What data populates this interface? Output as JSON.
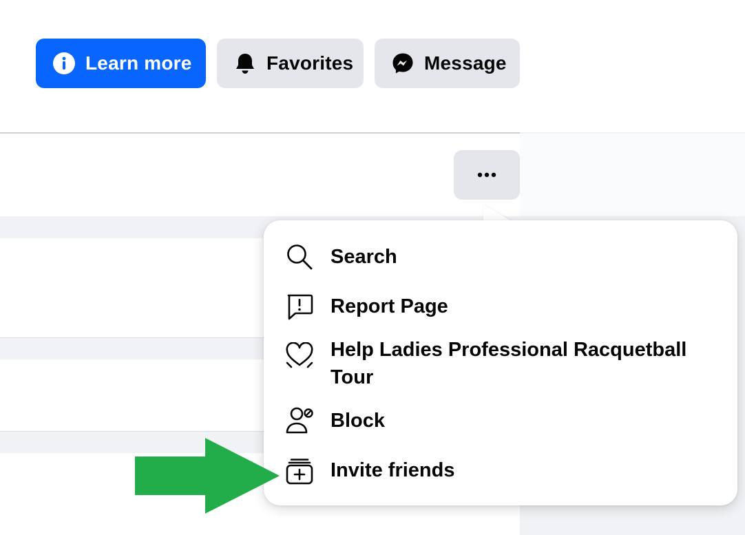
{
  "actions": {
    "learn_more": "Learn more",
    "favorites": "Favorites",
    "message": "Message"
  },
  "more_button": {
    "icon": "more-horizontal-icon"
  },
  "menu": {
    "items": [
      {
        "label": "Search",
        "icon": "search-icon"
      },
      {
        "label": "Report Page",
        "icon": "report-icon"
      },
      {
        "label": "Help Ladies Professional Racquetball Tour",
        "icon": "heart-icon"
      },
      {
        "label": "Block",
        "icon": "block-user-icon"
      },
      {
        "label": "Invite friends",
        "icon": "invite-icon"
      }
    ]
  },
  "colors": {
    "primary_blue": "#0866ff",
    "secondary_button": "#e4e6eb",
    "annotation_arrow": "#22ad4a",
    "page_background": "#f0f2f5"
  }
}
